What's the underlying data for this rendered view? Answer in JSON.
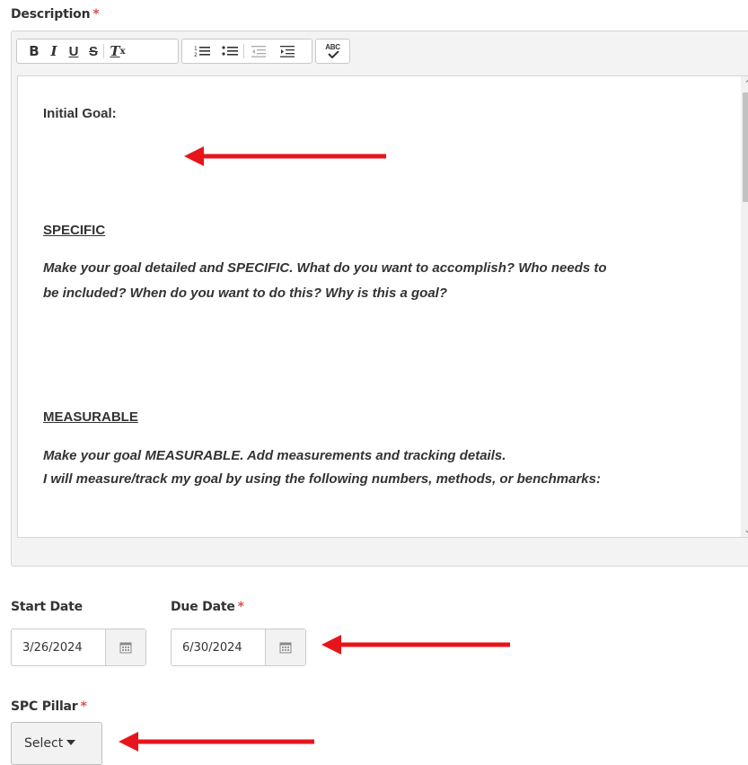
{
  "description": {
    "label": "Description",
    "required_mark": "*",
    "toolbar": {
      "bold": "B",
      "italic": "I",
      "underline": "U",
      "strike": "S",
      "clear_format": "Tx",
      "numbered_list": "numbered-list-icon",
      "bulleted_list": "bulleted-list-icon",
      "outdent": "outdent-icon",
      "indent": "indent-icon",
      "spellcheck": "ABC"
    },
    "content": {
      "initial_goal": "Initial Goal:",
      "specific_heading": "SPECIFIC",
      "specific_line1": "Make your goal detailed and SPECIFIC. What do you want to accomplish? Who needs to",
      "specific_line2": "be included? When do you want to do this? Why is this a goal?",
      "measurable_heading": "MEASURABLE",
      "measurable_line1": "Make your goal MEASURABLE. Add measurements and tracking details.",
      "measurable_line2": "I will measure/track my goal by using the following numbers, methods, or benchmarks:"
    }
  },
  "start_date": {
    "label": "Start Date",
    "value": "3/26/2024"
  },
  "due_date": {
    "label": "Due Date",
    "required_mark": "*",
    "value": "6/30/2024"
  },
  "spc_pillar": {
    "label": "SPC Pillar",
    "required_mark": "*",
    "selected": "Select"
  },
  "colors": {
    "required": "#d9534f",
    "arrow": "#e8141b"
  }
}
